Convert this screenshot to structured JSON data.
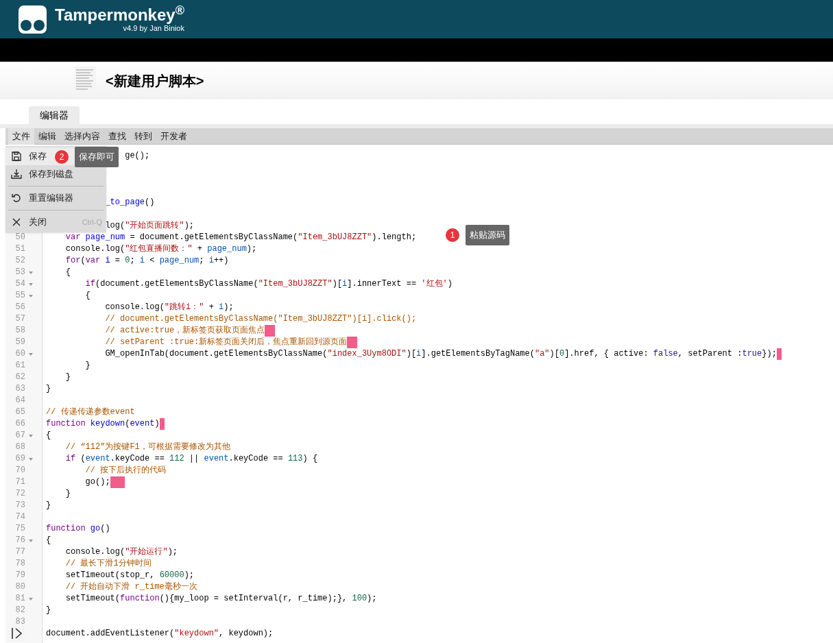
{
  "header": {
    "title": "Tampermonkey$^{®}$",
    "subtitle": "v4.9 by Jan Biniok"
  },
  "script_title": "<新建用户脚本>",
  "tabs": [
    {
      "label": "编辑器",
      "selected": true
    }
  ],
  "menubar": [
    {
      "label": "文件",
      "selected": true
    },
    {
      "label": "编辑",
      "selected": false
    },
    {
      "label": "选择内容",
      "selected": false
    },
    {
      "label": "查找",
      "selected": false
    },
    {
      "label": "转到",
      "selected": false
    },
    {
      "label": "开发者",
      "selected": false
    }
  ],
  "file_menu": [
    {
      "kind": "item",
      "label": "保存",
      "selected": true
    },
    {
      "kind": "item",
      "label": "保存到磁盘",
      "selected": false
    },
    {
      "kind": "separator"
    },
    {
      "kind": "item",
      "label": "重置编辑器",
      "selected": false
    },
    {
      "kind": "separator"
    },
    {
      "kind": "item",
      "label": "关闭",
      "shortcut": "Ctrl-Q",
      "selected": false
    }
  ],
  "annotations": [
    {
      "number": "2",
      "text": "保存即可"
    },
    {
      "number": "1",
      "text": "粘贴源码"
    }
  ],
  "code_lines": [
    {
      "kind": "code",
      "tokens": [
        {
          "kind": "plain",
          "text": "                ge();"
        }
      ]
    },
    {
      "kind": "blank"
    },
    {
      "kind": "blank"
    },
    {
      "kind": "blank"
    },
    {
      "kind": "code",
      "tokens": [
        {
          "kind": "definition",
          "text": "            _to_page"
        },
        {
          "kind": "plain",
          "text": "()"
        }
      ]
    },
    {
      "kind": "blank"
    },
    {
      "kind": "code",
      "tokens": [
        {
          "kind": "plain",
          "text": "            log("
        },
        {
          "kind": "string",
          "text": "\"开始页面跳转\""
        },
        {
          "kind": "plain",
          "text": ");"
        }
      ]
    },
    {
      "kind": "code",
      "number": "50",
      "tokens": [
        {
          "kind": "keyword",
          "text": "    var"
        },
        {
          "kind": "definition",
          "text": " page_num"
        },
        {
          "kind": "plain",
          "text": " = document.getElementsByClassName("
        },
        {
          "kind": "string",
          "text": "\"Item_3bUJ8ZZT\""
        },
        {
          "kind": "plain",
          "text": ").length;"
        }
      ]
    },
    {
      "kind": "code",
      "number": "51",
      "tokens": [
        {
          "kind": "plain",
          "text": "    console.log("
        },
        {
          "kind": "string",
          "text": "\"红包直播间数：\""
        },
        {
          "kind": "plain",
          "text": " + "
        },
        {
          "kind": "variable",
          "text": "page_num"
        },
        {
          "kind": "plain",
          "text": ");"
        }
      ]
    },
    {
      "kind": "code",
      "number": "52",
      "tokens": [
        {
          "kind": "keyword",
          "text": "    for"
        },
        {
          "kind": "plain",
          "text": "("
        },
        {
          "kind": "keyword",
          "text": "var"
        },
        {
          "kind": "definition",
          "text": " i"
        },
        {
          "kind": "plain",
          "text": " = "
        },
        {
          "kind": "number",
          "text": "0"
        },
        {
          "kind": "plain",
          "text": "; "
        },
        {
          "kind": "variable",
          "text": "i"
        },
        {
          "kind": "plain",
          "text": " < "
        },
        {
          "kind": "variable",
          "text": "page_num"
        },
        {
          "kind": "plain",
          "text": "; "
        },
        {
          "kind": "variable",
          "text": "i"
        },
        {
          "kind": "plain",
          "text": "++)"
        }
      ]
    },
    {
      "kind": "code",
      "number": "53",
      "fold": true,
      "tokens": [
        {
          "kind": "plain",
          "text": "    {"
        }
      ]
    },
    {
      "kind": "code",
      "number": "54",
      "fold": true,
      "tokens": [
        {
          "kind": "keyword",
          "text": "        if"
        },
        {
          "kind": "plain",
          "text": "(document.getElementsByClassName("
        },
        {
          "kind": "string",
          "text": "\"Item_3bUJ8ZZT\""
        },
        {
          "kind": "plain",
          "text": ")["
        },
        {
          "kind": "variable",
          "text": "i"
        },
        {
          "kind": "plain",
          "text": "].innerText == "
        },
        {
          "kind": "string",
          "text": "'红包'"
        },
        {
          "kind": "plain",
          "text": ")"
        }
      ]
    },
    {
      "kind": "code",
      "number": "55",
      "fold": true,
      "tokens": [
        {
          "kind": "plain",
          "text": "        {"
        }
      ]
    },
    {
      "kind": "code",
      "number": "56",
      "tokens": [
        {
          "kind": "plain",
          "text": "            console.log("
        },
        {
          "kind": "string",
          "text": "\"跳转i：\""
        },
        {
          "kind": "plain",
          "text": " + "
        },
        {
          "kind": "variable",
          "text": "i"
        },
        {
          "kind": "plain",
          "text": ");"
        }
      ]
    },
    {
      "kind": "code",
      "number": "57",
      "tokens": [
        {
          "kind": "comment",
          "text": "            // document.getElementsByClassName(\"Item_3bUJ8ZZT\")[i].click();"
        }
      ]
    },
    {
      "kind": "code",
      "number": "58",
      "trailing_whitespace": true,
      "tokens": [
        {
          "kind": "comment",
          "text": "            // active:true，新标签页获取页面焦点  "
        }
      ]
    },
    {
      "kind": "code",
      "number": "59",
      "trailing_whitespace": true,
      "tokens": [
        {
          "kind": "comment",
          "text": "            // setParent :true:新标签页面关闭后，焦点重新回到源页面  "
        }
      ]
    },
    {
      "kind": "code",
      "number": "60",
      "fold": true,
      "trailing_whitespace": true,
      "tokens": [
        {
          "kind": "plain",
          "text": "            GM_openInTab(document.getElementsByClassName("
        },
        {
          "kind": "string",
          "text": "\"index_3Uym8ODI\""
        },
        {
          "kind": "plain",
          "text": ")["
        },
        {
          "kind": "variable",
          "text": "i"
        },
        {
          "kind": "plain",
          "text": "].getElementsByTagName("
        },
        {
          "kind": "string",
          "text": "\"a\""
        },
        {
          "kind": "plain",
          "text": ")["
        },
        {
          "kind": "number",
          "text": "0"
        },
        {
          "kind": "plain",
          "text": "].href, { active: "
        },
        {
          "kind": "atom",
          "text": "false"
        },
        {
          "kind": "plain",
          "text": ", setParent :"
        },
        {
          "kind": "atom",
          "text": "true"
        },
        {
          "kind": "plain",
          "text": "}); "
        }
      ]
    },
    {
      "kind": "code",
      "number": "61",
      "tokens": [
        {
          "kind": "plain",
          "text": "        }"
        }
      ]
    },
    {
      "kind": "code",
      "number": "62",
      "tokens": [
        {
          "kind": "plain",
          "text": "    }"
        }
      ]
    },
    {
      "kind": "code",
      "number": "63",
      "tokens": [
        {
          "kind": "plain",
          "text": "}"
        }
      ]
    },
    {
      "kind": "blank",
      "number": "64"
    },
    {
      "kind": "code",
      "number": "65",
      "tokens": [
        {
          "kind": "comment",
          "text": "// 传递传递参数event"
        }
      ]
    },
    {
      "kind": "code",
      "number": "66",
      "trailing_whitespace": true,
      "tokens": [
        {
          "kind": "keyword",
          "text": "function"
        },
        {
          "kind": "definition",
          "text": " keydown"
        },
        {
          "kind": "plain",
          "text": "("
        },
        {
          "kind": "definition",
          "text": "event"
        },
        {
          "kind": "plain",
          "text": ") "
        }
      ]
    },
    {
      "kind": "code",
      "number": "67",
      "fold": true,
      "tokens": [
        {
          "kind": "plain",
          "text": "{"
        }
      ]
    },
    {
      "kind": "code",
      "number": "68",
      "tokens": [
        {
          "kind": "comment",
          "text": "    // “112”为按键F1，可根据需要修改为其他"
        }
      ]
    },
    {
      "kind": "code",
      "number": "69",
      "fold": true,
      "tokens": [
        {
          "kind": "keyword",
          "text": "    if"
        },
        {
          "kind": "plain",
          "text": " ("
        },
        {
          "kind": "variable",
          "text": "event"
        },
        {
          "kind": "plain",
          "text": ".keyCode == "
        },
        {
          "kind": "number",
          "text": "112"
        },
        {
          "kind": "plain",
          "text": " || "
        },
        {
          "kind": "variable",
          "text": "event"
        },
        {
          "kind": "plain",
          "text": ".keyCode == "
        },
        {
          "kind": "number",
          "text": "113"
        },
        {
          "kind": "plain",
          "text": ") {"
        }
      ]
    },
    {
      "kind": "code",
      "number": "70",
      "tokens": [
        {
          "kind": "comment",
          "text": "        // 按下后执行的代码"
        }
      ]
    },
    {
      "kind": "code",
      "number": "71",
      "trailing_whitespace": true,
      "tokens": [
        {
          "kind": "plain",
          "text": "        go();   "
        }
      ]
    },
    {
      "kind": "code",
      "number": "72",
      "tokens": [
        {
          "kind": "plain",
          "text": "    }"
        }
      ]
    },
    {
      "kind": "code",
      "number": "73",
      "tokens": [
        {
          "kind": "plain",
          "text": "}"
        }
      ]
    },
    {
      "kind": "blank",
      "number": "74"
    },
    {
      "kind": "code",
      "number": "75",
      "tokens": [
        {
          "kind": "keyword",
          "text": "function"
        },
        {
          "kind": "definition",
          "text": " go"
        },
        {
          "kind": "plain",
          "text": "()"
        }
      ]
    },
    {
      "kind": "code",
      "number": "76",
      "fold": true,
      "tokens": [
        {
          "kind": "plain",
          "text": "{"
        }
      ]
    },
    {
      "kind": "code",
      "number": "77",
      "tokens": [
        {
          "kind": "plain",
          "text": "    console.log("
        },
        {
          "kind": "string",
          "text": "\"开始运行\""
        },
        {
          "kind": "plain",
          "text": ");"
        }
      ]
    },
    {
      "kind": "code",
      "number": "78",
      "tokens": [
        {
          "kind": "comment",
          "text": "    // 最长下滑1分钟时间"
        }
      ]
    },
    {
      "kind": "code",
      "number": "79",
      "tokens": [
        {
          "kind": "plain",
          "text": "    setTimeout(stop_r, "
        },
        {
          "kind": "number",
          "text": "60000"
        },
        {
          "kind": "plain",
          "text": ");"
        }
      ]
    },
    {
      "kind": "code",
      "number": "80",
      "tokens": [
        {
          "kind": "comment",
          "text": "    // 开始自动下滑 r_time毫秒一次"
        }
      ]
    },
    {
      "kind": "code",
      "number": "81",
      "fold": true,
      "tokens": [
        {
          "kind": "plain",
          "text": "    setTimeout("
        },
        {
          "kind": "keyword",
          "text": "function"
        },
        {
          "kind": "plain",
          "text": "(){my_loop = setInterval(r, r_time);}, "
        },
        {
          "kind": "number",
          "text": "100"
        },
        {
          "kind": "plain",
          "text": ");"
        }
      ]
    },
    {
      "kind": "code",
      "number": "82",
      "tokens": [
        {
          "kind": "plain",
          "text": "}"
        }
      ]
    },
    {
      "kind": "blank",
      "number": "83"
    },
    {
      "kind": "code",
      "tokens": [
        {
          "kind": "plain",
          "text": "document.addEventListener("
        },
        {
          "kind": "string",
          "text": "\"keydown\""
        },
        {
          "kind": "plain",
          "text": ", keydown);"
        }
      ]
    }
  ]
}
